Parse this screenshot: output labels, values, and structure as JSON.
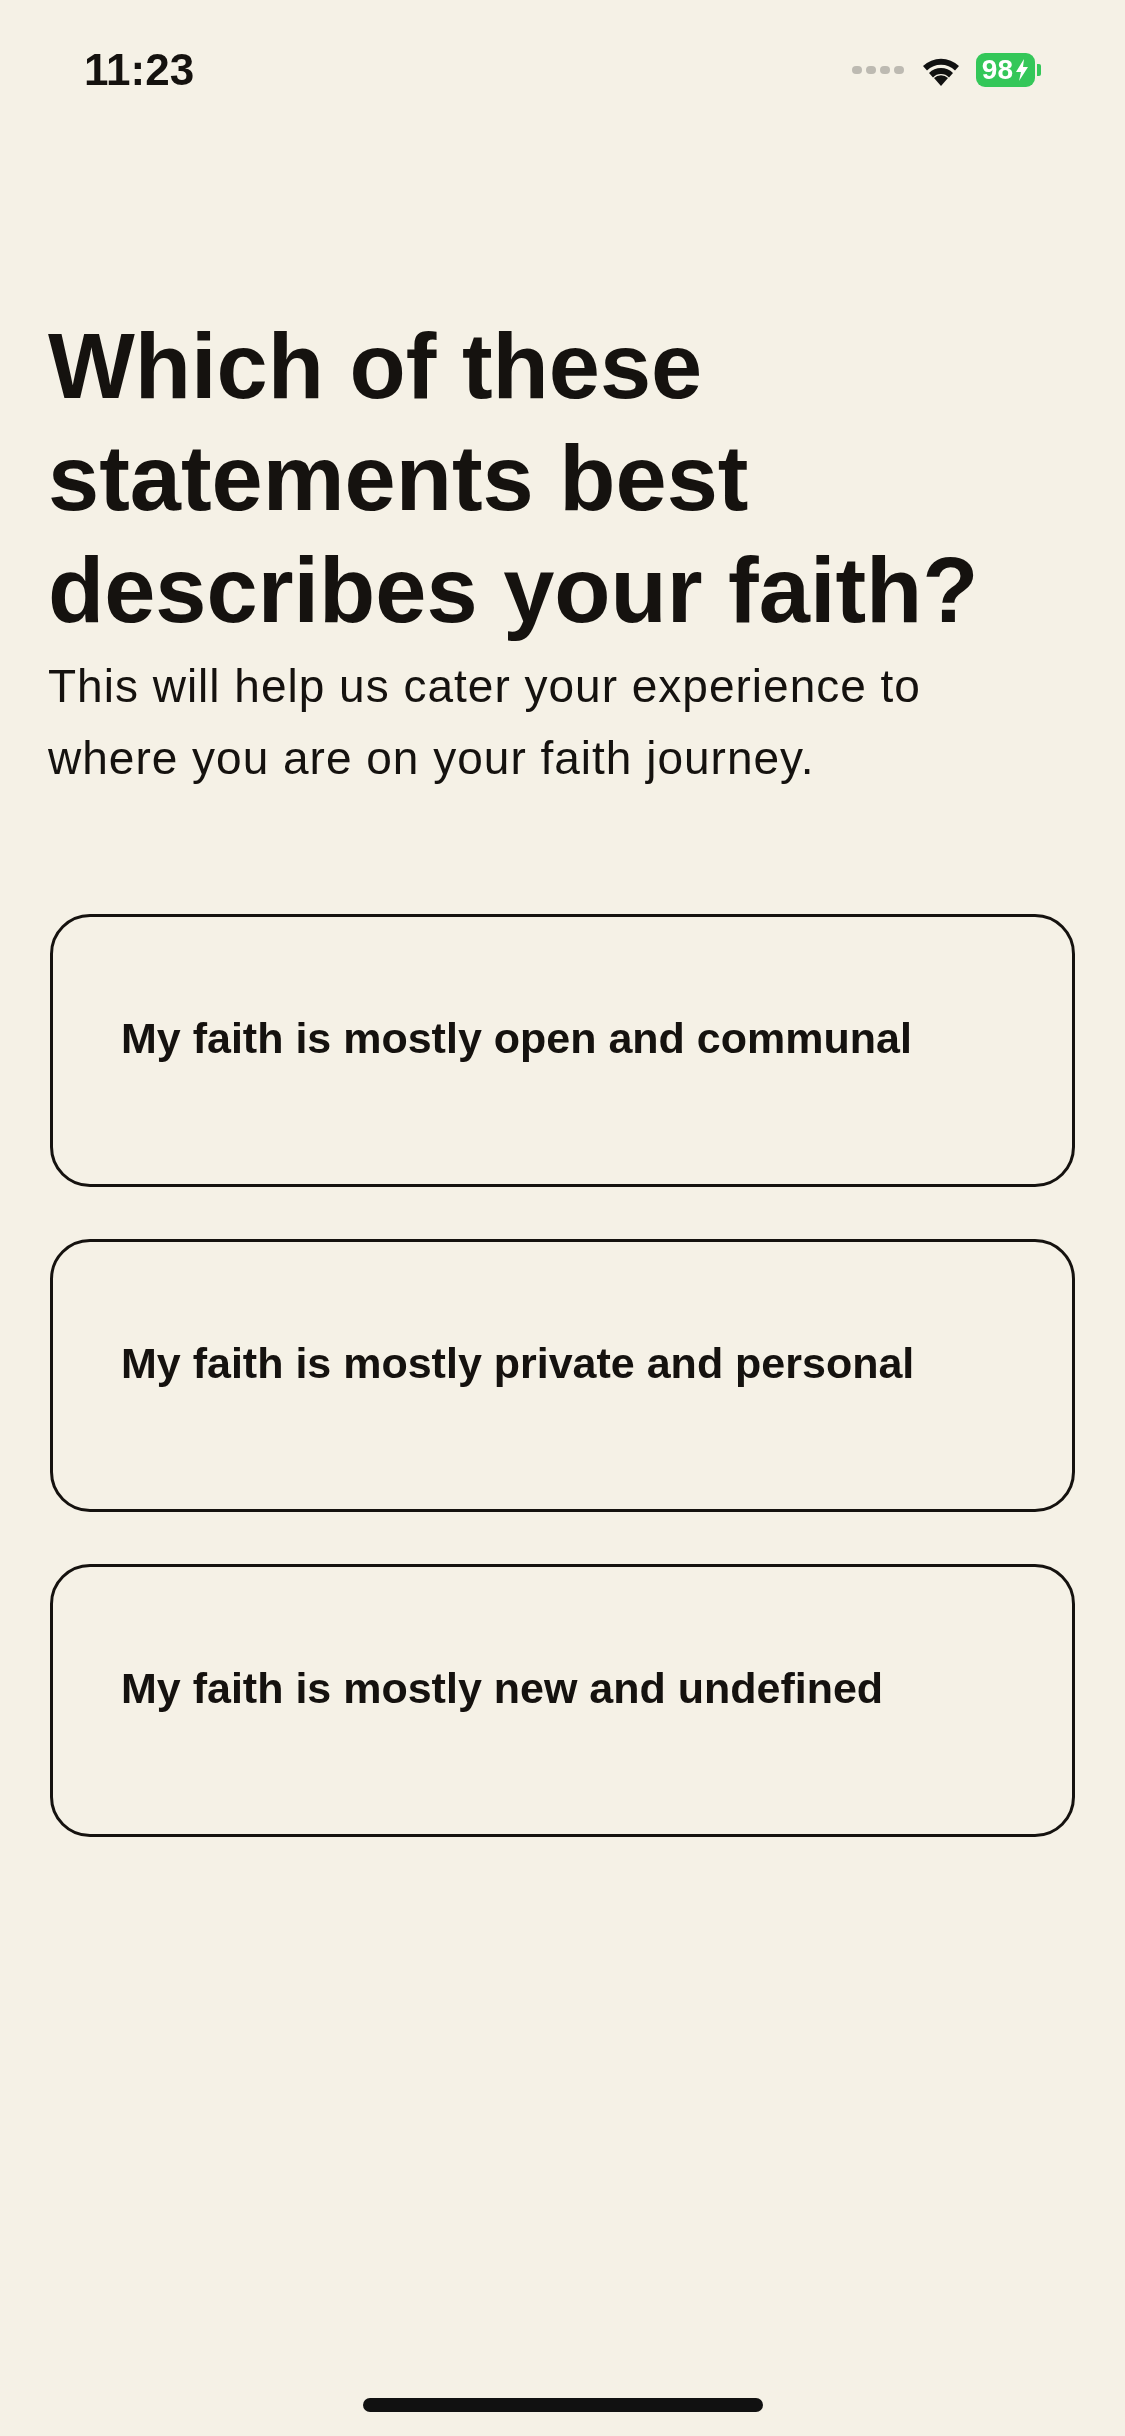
{
  "status_bar": {
    "time": "11:23",
    "battery": "98"
  },
  "title": "Which of these statements best describes your faith?",
  "subtitle": "This will help us cater your experience to where you are on your faith journey.",
  "options": [
    {
      "label": "My faith is mostly open and communal",
      "selected": false
    },
    {
      "label": "My faith is mostly private and personal",
      "selected": false
    },
    {
      "label": "My faith is mostly new and undefined",
      "selected": false
    }
  ]
}
